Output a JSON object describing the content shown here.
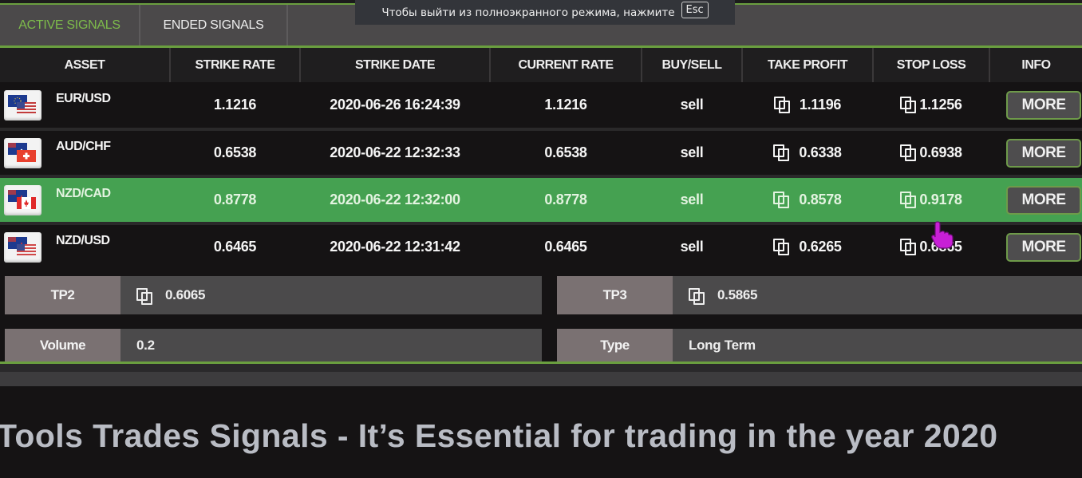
{
  "fullscreen_notice": {
    "text": "Чтобы выйти из полноэкранного режима, нажмите",
    "key": "Esc"
  },
  "tabs": [
    {
      "label": "ACTIVE SIGNALS",
      "active": true
    },
    {
      "label": "ENDED SIGNALS",
      "active": false
    }
  ],
  "table": {
    "columns": [
      "ASSET",
      "STRIKE RATE",
      "STRIKE DATE",
      "CURRENT RATE",
      "BUY/SELL",
      "TAKE PROFIT",
      "STOP LOSS",
      "INFO"
    ],
    "rows": [
      {
        "asset": "EUR/USD",
        "flag_icon": "eur-usd-flag-icon",
        "strike_rate": "1.1216",
        "strike_date": "2020-06-26 16:24:39",
        "current_rate": "1.1216",
        "direction": "sell",
        "take_profit": "1.1196",
        "stop_loss": "1.1256",
        "info_label": "MORE",
        "selected": false
      },
      {
        "asset": "AUD/CHF",
        "flag_icon": "aud-chf-flag-icon",
        "strike_rate": "0.6538",
        "strike_date": "2020-06-22 12:32:33",
        "current_rate": "0.6538",
        "direction": "sell",
        "take_profit": "0.6338",
        "stop_loss": "0.6938",
        "info_label": "MORE",
        "selected": false
      },
      {
        "asset": "NZD/CAD",
        "flag_icon": "nzd-cad-flag-icon",
        "strike_rate": "0.8778",
        "strike_date": "2020-06-22 12:32:00",
        "current_rate": "0.8778",
        "direction": "sell",
        "take_profit": "0.8578",
        "stop_loss": "0.9178",
        "info_label": "MORE",
        "selected": true
      },
      {
        "asset": "NZD/USD",
        "flag_icon": "nzd-usd-flag-icon",
        "strike_rate": "0.6465",
        "strike_date": "2020-06-22 12:31:42",
        "current_rate": "0.6465",
        "direction": "sell",
        "take_profit": "0.6265",
        "stop_loss": "0.6865",
        "info_label": "MORE",
        "selected": false
      }
    ]
  },
  "details": {
    "tp2": {
      "label": "TP2",
      "value": "0.6065"
    },
    "tp3": {
      "label": "TP3",
      "value": "0.5865"
    },
    "volume": {
      "label": "Volume",
      "value": "0.2"
    },
    "type": {
      "label": "Type",
      "value": "Long Term"
    }
  },
  "headline": "Tools Trades Signals - It’s Essential for trading in the year 2020",
  "colors": {
    "accent_green": "#6a9f3f",
    "active_tab": "#7dbb4b",
    "selected_row": "#45a151",
    "background": "#151314"
  }
}
